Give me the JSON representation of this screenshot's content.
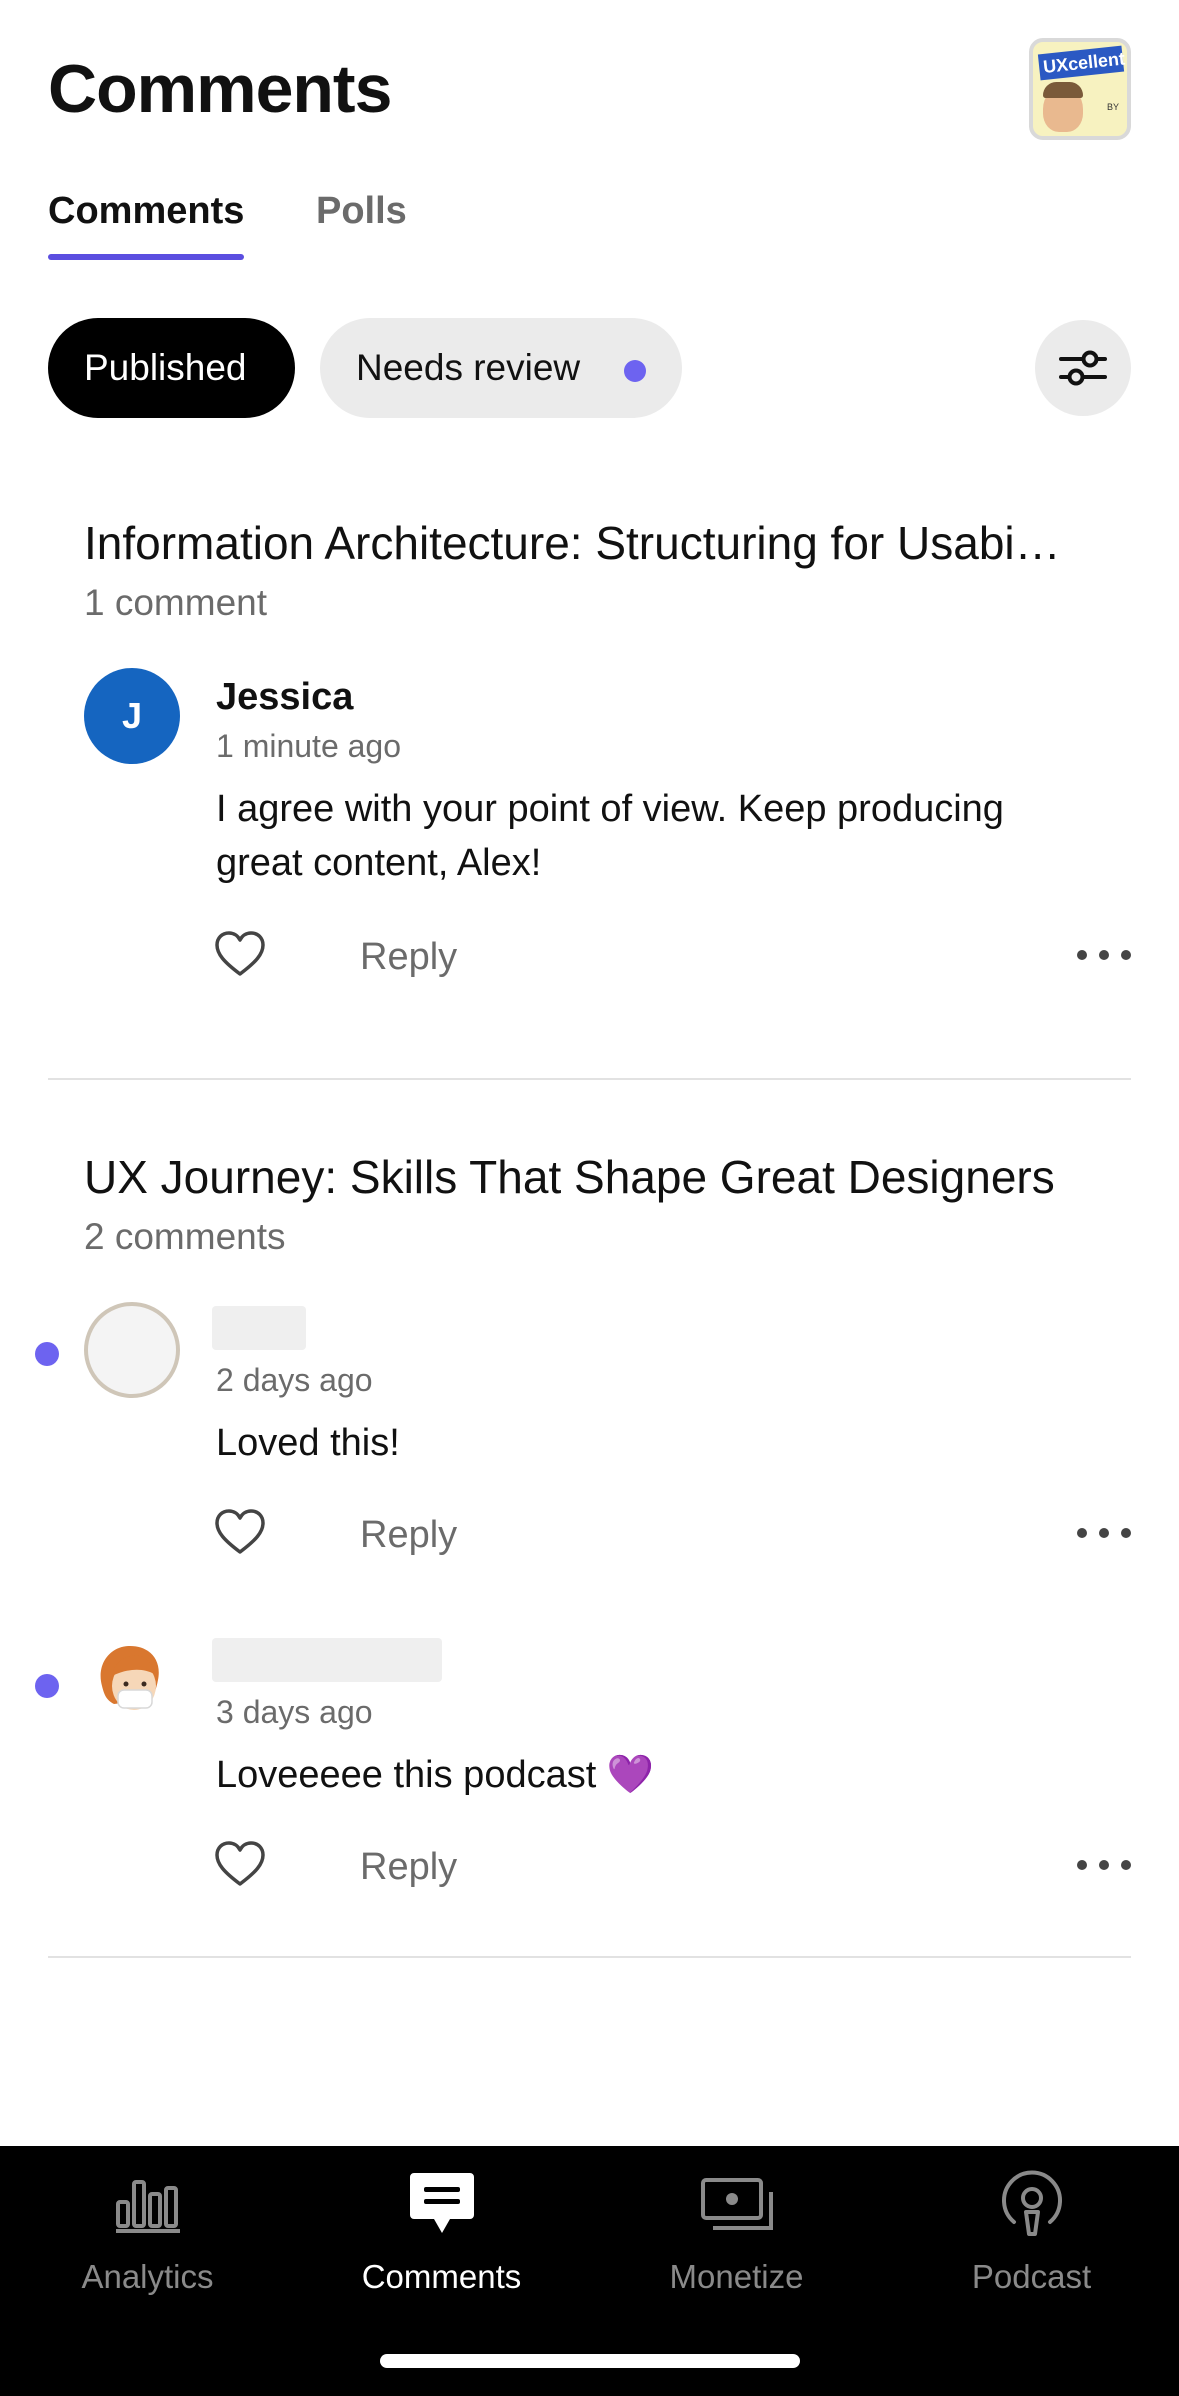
{
  "header": {
    "title": "Comments"
  },
  "tabs": [
    {
      "label": "Comments"
    },
    {
      "label": "Polls"
    }
  ],
  "filters": {
    "published_label": "Published",
    "review_label": "Needs review"
  },
  "sections": [
    {
      "title": "Information Architecture: Structuring for Usabi…",
      "count": "1 comment",
      "comments": [
        {
          "author": "Jessica",
          "initial": "J",
          "time": "1 minute ago",
          "text": "I agree with your point of view. Keep producing great content, Alex!",
          "reply_label": "Reply"
        }
      ]
    },
    {
      "title": "UX Journey: Skills That Shape Great Designers",
      "count": "2 comments",
      "comments": [
        {
          "time": "2 days ago",
          "text": "Loved this!",
          "reply_label": "Reply"
        },
        {
          "time": "3 days ago",
          "text": "Loveeeee this podcast 💜",
          "reply_label": "Reply"
        }
      ]
    }
  ],
  "bottom_nav": [
    {
      "label": "Analytics",
      "icon": "bar-chart-icon"
    },
    {
      "label": "Comments",
      "icon": "comment-icon"
    },
    {
      "label": "Monetize",
      "icon": "money-icon"
    },
    {
      "label": "Podcast",
      "icon": "podcast-icon"
    }
  ],
  "colors": {
    "accent": "#5b4ee0",
    "unread_dot": "#6d63f0",
    "avatar_j": "#1565c0"
  }
}
